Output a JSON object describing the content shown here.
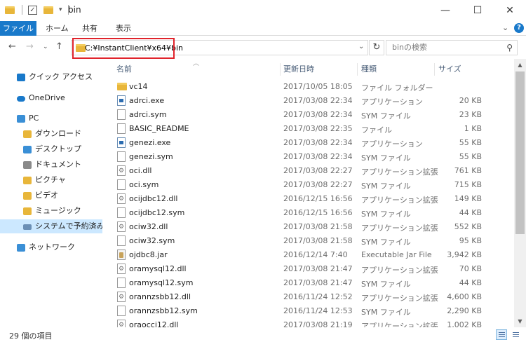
{
  "window": {
    "title": "bin"
  },
  "ribbon": {
    "tabs": [
      "ファイル",
      "ホーム",
      "共有",
      "表示"
    ]
  },
  "address": {
    "path": "C:¥InstantClient¥x64¥bin",
    "highlight_color": "#e0232b"
  },
  "search": {
    "placeholder": "binの検索"
  },
  "nav": {
    "items": [
      {
        "label": "クイック アクセス",
        "icon": "star-icon",
        "color": "#1979ca"
      },
      {
        "label": "OneDrive",
        "icon": "cloud-icon",
        "color": "#1979ca"
      },
      {
        "label": "PC",
        "icon": "pc-icon",
        "color": "#3a8fd6"
      },
      {
        "label": "ダウンロード",
        "icon": "download-folder-icon",
        "color": "#e8b63a"
      },
      {
        "label": "デスクトップ",
        "icon": "desktop-folder-icon",
        "color": "#3a8fd6"
      },
      {
        "label": "ドキュメント",
        "icon": "documents-folder-icon",
        "color": "#8a8a8a"
      },
      {
        "label": "ピクチャ",
        "icon": "pictures-folder-icon",
        "color": "#e8b63a"
      },
      {
        "label": "ビデオ",
        "icon": "videos-folder-icon",
        "color": "#e8b63a"
      },
      {
        "label": "ミュージック",
        "icon": "music-folder-icon",
        "color": "#e8b63a"
      },
      {
        "label": "システムで予約済み (C",
        "icon": "drive-icon",
        "color": "#6b8fb5",
        "selected": true
      },
      {
        "label": "ネットワーク",
        "icon": "network-icon",
        "color": "#3a8fd6"
      }
    ]
  },
  "columns": {
    "name": "名前",
    "date": "更新日時",
    "type": "種類",
    "size": "サイズ"
  },
  "files": [
    {
      "name": "vc14",
      "date": "2017/10/05 18:05",
      "type": "ファイル フォルダー",
      "size": "",
      "kind": "folder"
    },
    {
      "name": "adrci.exe",
      "date": "2017/03/08 22:34",
      "type": "アプリケーション",
      "size": "20 KB",
      "kind": "exe"
    },
    {
      "name": "adrci.sym",
      "date": "2017/03/08 22:34",
      "type": "SYM ファイル",
      "size": "23 KB",
      "kind": "file"
    },
    {
      "name": "BASIC_README",
      "date": "2017/03/08 22:35",
      "type": "ファイル",
      "size": "1 KB",
      "kind": "file"
    },
    {
      "name": "genezi.exe",
      "date": "2017/03/08 22:34",
      "type": "アプリケーション",
      "size": "55 KB",
      "kind": "exe"
    },
    {
      "name": "genezi.sym",
      "date": "2017/03/08 22:34",
      "type": "SYM ファイル",
      "size": "55 KB",
      "kind": "file"
    },
    {
      "name": "oci.dll",
      "date": "2017/03/08 22:27",
      "type": "アプリケーション拡張",
      "size": "761 KB",
      "kind": "dll"
    },
    {
      "name": "oci.sym",
      "date": "2017/03/08 22:27",
      "type": "SYM ファイル",
      "size": "715 KB",
      "kind": "file"
    },
    {
      "name": "ocijdbc12.dll",
      "date": "2016/12/15 16:56",
      "type": "アプリケーション拡張",
      "size": "149 KB",
      "kind": "dll"
    },
    {
      "name": "ocijdbc12.sym",
      "date": "2016/12/15 16:56",
      "type": "SYM ファイル",
      "size": "44 KB",
      "kind": "file"
    },
    {
      "name": "ociw32.dll",
      "date": "2017/03/08 21:58",
      "type": "アプリケーション拡張",
      "size": "552 KB",
      "kind": "dll"
    },
    {
      "name": "ociw32.sym",
      "date": "2017/03/08 21:58",
      "type": "SYM ファイル",
      "size": "95 KB",
      "kind": "file"
    },
    {
      "name": "ojdbc8.jar",
      "date": "2016/12/14 7:40",
      "type": "Executable Jar File",
      "size": "3,942 KB",
      "kind": "jar"
    },
    {
      "name": "oramysql12.dll",
      "date": "2017/03/08 21:47",
      "type": "アプリケーション拡張",
      "size": "70 KB",
      "kind": "dll"
    },
    {
      "name": "oramysql12.sym",
      "date": "2017/03/08 21:47",
      "type": "SYM ファイル",
      "size": "44 KB",
      "kind": "file"
    },
    {
      "name": "orannzsbb12.dll",
      "date": "2016/11/24 12:52",
      "type": "アプリケーション拡張",
      "size": "4,600 KB",
      "kind": "dll"
    },
    {
      "name": "orannzsbb12.sym",
      "date": "2016/11/24 12:53",
      "type": "SYM ファイル",
      "size": "2,290 KB",
      "kind": "file"
    },
    {
      "name": "oraocci12.dll",
      "date": "2017/03/08 21:19",
      "type": "アプリケーション拡張",
      "size": "1,002 KB",
      "kind": "dll"
    }
  ],
  "status": {
    "item_count": "29 個の項目"
  }
}
